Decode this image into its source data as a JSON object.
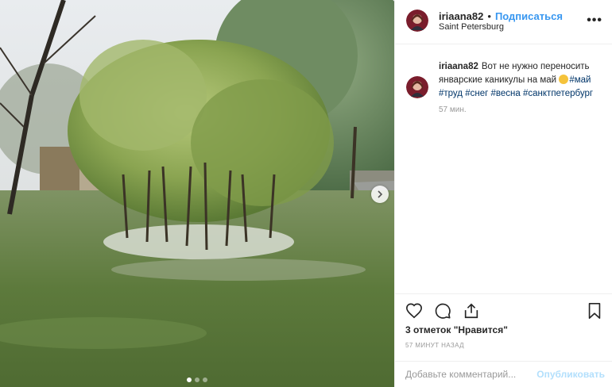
{
  "post": {
    "username": "iriaana82",
    "separator": "•",
    "follow_label": "Подписаться",
    "location": "Saint Petersburg",
    "more_label": "•••"
  },
  "caption": {
    "username": "iriaana82",
    "text": "Вот не нужно переносить январские каникулы на май",
    "emoji": "grimacing-face-emoji",
    "hashtags": [
      "#май",
      "#труд",
      "#снег",
      "#весна",
      "#санктпетербург"
    ],
    "time": "57 мин."
  },
  "actions": {
    "likes": "3 отметок \"Нравится\"",
    "timestamp": "57 МИНУТ НАЗАД",
    "comment_placeholder": "Добавьте комментарий...",
    "publish_label": "Опубликовать"
  },
  "carousel": {
    "slides": 3,
    "active_slide": 1
  },
  "colors": {
    "link_blue": "#3897f0",
    "hashtag": "#003569",
    "publish_disabled": "#b2dffc",
    "muted_text": "#999999",
    "divider": "#efefef"
  },
  "icons": [
    "heart-icon",
    "comment-icon",
    "share-icon",
    "bookmark-icon",
    "next-arrow-icon",
    "more-icon"
  ]
}
